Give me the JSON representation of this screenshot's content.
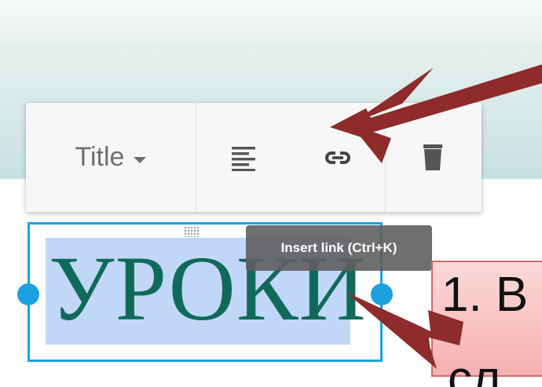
{
  "toolbar": {
    "style_dropdown_label": "Title",
    "buttons": {
      "align": "align-left-icon",
      "link": "link-icon",
      "delete": "trash-icon"
    }
  },
  "tooltip": {
    "text": "Insert link (Ctrl+K)"
  },
  "content": {
    "heading_text": "УРОКИ"
  },
  "callout": {
    "line1": "1. В",
    "line2": "сл"
  },
  "colors": {
    "selection_border": "#1aa1e0",
    "heading_text": "#0f6a5a",
    "selection_highlight": "#c1d7f7",
    "arrow": "#8e2b2b",
    "callout_fill": "#f6b0b0"
  }
}
